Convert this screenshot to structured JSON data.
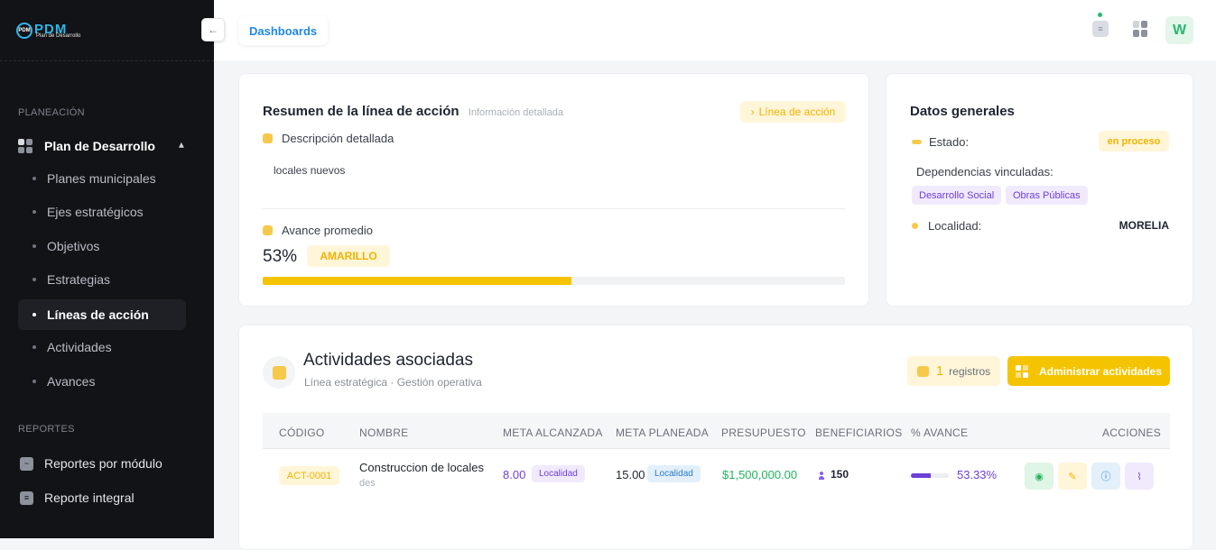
{
  "app": {
    "logo_text": "PDM",
    "logo_subtitle": "Plan de Desarrollo",
    "logo_mark": "PDM"
  },
  "sidebar": {
    "section_planeacion": "PLANEACIÓN",
    "group_label": "Plan de Desarrollo",
    "items": [
      {
        "label": "Planes municipales"
      },
      {
        "label": "Ejes estratégicos"
      },
      {
        "label": "Objetivos"
      },
      {
        "label": "Estrategias"
      },
      {
        "label": "Líneas de acción",
        "active": true
      },
      {
        "label": "Actividades"
      },
      {
        "label": "Avances"
      }
    ],
    "section_reportes": "REPORTES",
    "reports": [
      {
        "label": "Reportes por módulo"
      },
      {
        "label": "Reporte integral"
      }
    ]
  },
  "topbar": {
    "breadcrumb": "Dashboards",
    "avatar_letter": "W",
    "collapse_icon": "←"
  },
  "summary": {
    "title": "Resumen de la línea de acción",
    "subtitle": "Información detallada",
    "chip": "Línea de acción",
    "chip_icon": "›",
    "desc_label": "Descripción detallada",
    "desc_value": "locales nuevos",
    "progress_label": "Avance promedio",
    "progress_value": "53%",
    "progress_fraction": 0.53,
    "progress_status": "AMARILLO"
  },
  "general": {
    "title": "Datos generales",
    "estado_label": "Estado:",
    "estado_value": "en proceso",
    "dependencias_label": "Dependencias vinculadas:",
    "dependencias": [
      "Desarrollo Social",
      "Obras Públicas"
    ],
    "localidad_label": "Localidad:",
    "localidad_value": "MORELIA"
  },
  "activities": {
    "title": "Actividades asociadas",
    "subtitle": "Línea estratégica · Gestión operativa",
    "count": "1",
    "count_label": "registros",
    "manage_button": "Administrar actividades",
    "columns": [
      "CÓDIGO",
      "NOMBRE",
      "META ALCANZADA",
      "META PLANEADA",
      "PRESUPUESTO",
      "BENEFICIARIOS",
      "% AVANCE",
      "ACCIONES"
    ],
    "rows": [
      {
        "code": "ACT-0001",
        "name": "Construccion de locales",
        "name_sub": "des",
        "meta_alcanzada": "8.00",
        "meta_alcanzada_tag": "Localidad",
        "meta_planeada": "15.00",
        "meta_planeada_tag": "Localidad",
        "presupuesto": "$1,500,000.00",
        "beneficiarios": "150",
        "avance": "53.33%",
        "avance_fraction": 0.5333
      }
    ]
  },
  "colors": {
    "accent": "#f5c400",
    "primary_blue": "#1e88e5",
    "success": "#22b35e",
    "purple": "#6f3fd6",
    "sidebar_bg": "#121316"
  }
}
